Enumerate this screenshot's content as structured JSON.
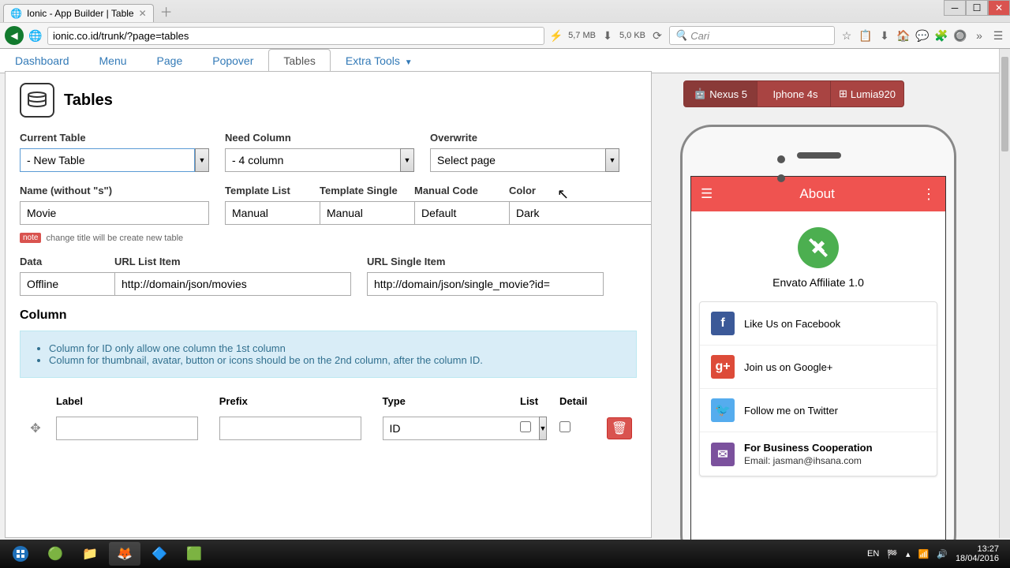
{
  "browser": {
    "tab_title": "Ionic - App Builder | Table",
    "url": "ionic.co.id/trunk/?page=tables",
    "mem1": "5,7 MB",
    "mem2": "5,0 KB",
    "search_placeholder": "Cari"
  },
  "nav": {
    "items": [
      "Dashboard",
      "Menu",
      "Page",
      "Popover",
      "Tables",
      "Extra Tools"
    ],
    "active": 4
  },
  "panel": {
    "title": "Tables",
    "current_table_label": "Current Table",
    "current_table_value": "- New Table",
    "need_column_label": "Need Column",
    "need_column_value": "- 4 column",
    "overwrite_label": "Overwrite",
    "overwrite_value": "Select page",
    "name_label": "Name (without \"s\")",
    "name_value": "Movie",
    "name_note": "change title will be create new table",
    "template_list_label": "Template List",
    "template_list_value": "Manual",
    "template_single_label": "Template Single",
    "template_single_value": "Manual",
    "manual_code_label": "Manual Code",
    "manual_code_value": "Default",
    "color_label": "Color",
    "color_value": "Dark",
    "data_label": "Data",
    "data_value": "Offline",
    "url_list_label": "URL List Item",
    "url_list_value": "http://domain/json/movies",
    "url_single_label": "URL Single Item",
    "url_single_value": "http://domain/json/single_movie?id=",
    "column_title": "Column",
    "info_1": "Column for ID only allow one column the 1st column",
    "info_2": "Column for thumbnail, avatar, button or icons should be on the 2nd column, after the column ID.",
    "th_label": "Label",
    "th_prefix": "Prefix",
    "th_type": "Type",
    "th_list": "List",
    "th_detail": "Detail",
    "row_type_value": "ID"
  },
  "devices": {
    "nexus": "Nexus 5",
    "iphone": "Iphone 4s",
    "lumia": "Lumia920"
  },
  "app": {
    "header": "About",
    "name": "Envato Affiliate 1.0",
    "fb": "Like Us on Facebook",
    "gp": "Join us on Google+",
    "tw": "Follow me on Twitter",
    "em_title": "For Business Cooperation",
    "em_sub": "Email: jasman@ihsana.com"
  },
  "tray": {
    "lang": "EN",
    "time": "13:27",
    "date": "18/04/2016"
  }
}
